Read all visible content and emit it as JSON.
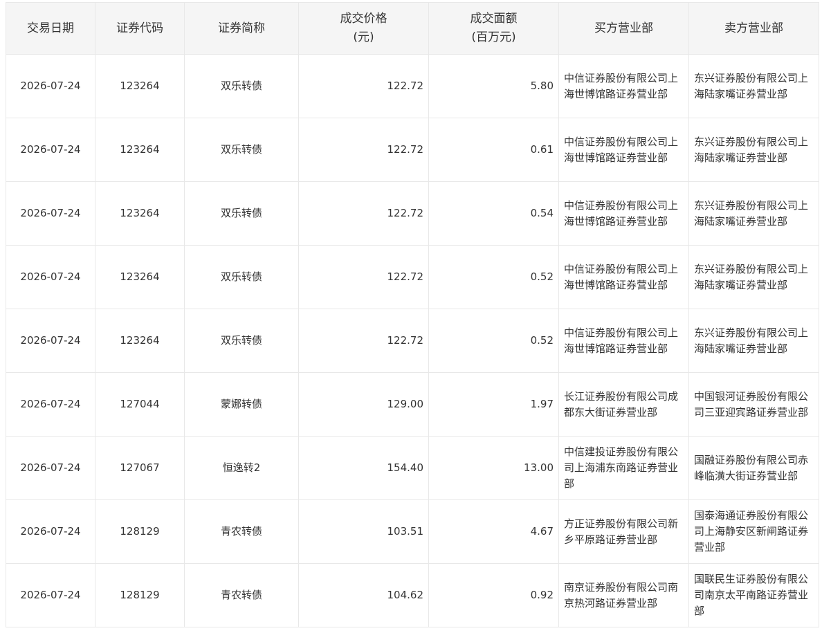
{
  "headers": [
    {
      "line1": "交易日期",
      "line2": ""
    },
    {
      "line1": "证券代码",
      "line2": ""
    },
    {
      "line1": "证券简称",
      "line2": ""
    },
    {
      "line1": "成交价格",
      "line2": "(元)"
    },
    {
      "line1": "成交面额",
      "line2": "(百万元)"
    },
    {
      "line1": "买方营业部",
      "line2": ""
    },
    {
      "line1": "卖方营业部",
      "line2": ""
    }
  ],
  "rows": [
    {
      "date": "2026-07-24",
      "code": "123264",
      "name": "双乐转债",
      "price": "122.72",
      "amount": "5.80",
      "buyer": "中信证券股份有限公司上海世博馆路证券营业部",
      "seller": "东兴证券股份有限公司上海陆家嘴证券营业部"
    },
    {
      "date": "2026-07-24",
      "code": "123264",
      "name": "双乐转债",
      "price": "122.72",
      "amount": "0.61",
      "buyer": "中信证券股份有限公司上海世博馆路证券营业部",
      "seller": "东兴证券股份有限公司上海陆家嘴证券营业部"
    },
    {
      "date": "2026-07-24",
      "code": "123264",
      "name": "双乐转债",
      "price": "122.72",
      "amount": "0.54",
      "buyer": "中信证券股份有限公司上海世博馆路证券营业部",
      "seller": "东兴证券股份有限公司上海陆家嘴证券营业部"
    },
    {
      "date": "2026-07-24",
      "code": "123264",
      "name": "双乐转债",
      "price": "122.72",
      "amount": "0.52",
      "buyer": "中信证券股份有限公司上海世博馆路证券营业部",
      "seller": "东兴证券股份有限公司上海陆家嘴证券营业部"
    },
    {
      "date": "2026-07-24",
      "code": "123264",
      "name": "双乐转债",
      "price": "122.72",
      "amount": "0.52",
      "buyer": "中信证券股份有限公司上海世博馆路证券营业部",
      "seller": "东兴证券股份有限公司上海陆家嘴证券营业部"
    },
    {
      "date": "2026-07-24",
      "code": "127044",
      "name": "蒙娜转债",
      "price": "129.00",
      "amount": "1.97",
      "buyer": "长江证券股份有限公司成都东大街证券营业部",
      "seller": "中国银河证券股份有限公司三亚迎宾路证券营业部"
    },
    {
      "date": "2026-07-24",
      "code": "127067",
      "name": "恒逸转2",
      "price": "154.40",
      "amount": "13.00",
      "buyer": "中信建投证券股份有限公司上海浦东南路证券营业部",
      "seller": "国融证券股份有限公司赤峰临潢大街证券营业部"
    },
    {
      "date": "2026-07-24",
      "code": "128129",
      "name": "青农转债",
      "price": "103.51",
      "amount": "4.67",
      "buyer": "方正证券股份有限公司新乡平原路证券营业部",
      "seller": "国泰海通证券股份有限公司上海静安区新闸路证券营业部"
    },
    {
      "date": "2026-07-24",
      "code": "128129",
      "name": "青农转债",
      "price": "104.62",
      "amount": "0.92",
      "buyer": "南京证券股份有限公司南京热河路证券营业部",
      "seller": "国联民生证券股份有限公司南京太平南路证券营业部"
    }
  ]
}
